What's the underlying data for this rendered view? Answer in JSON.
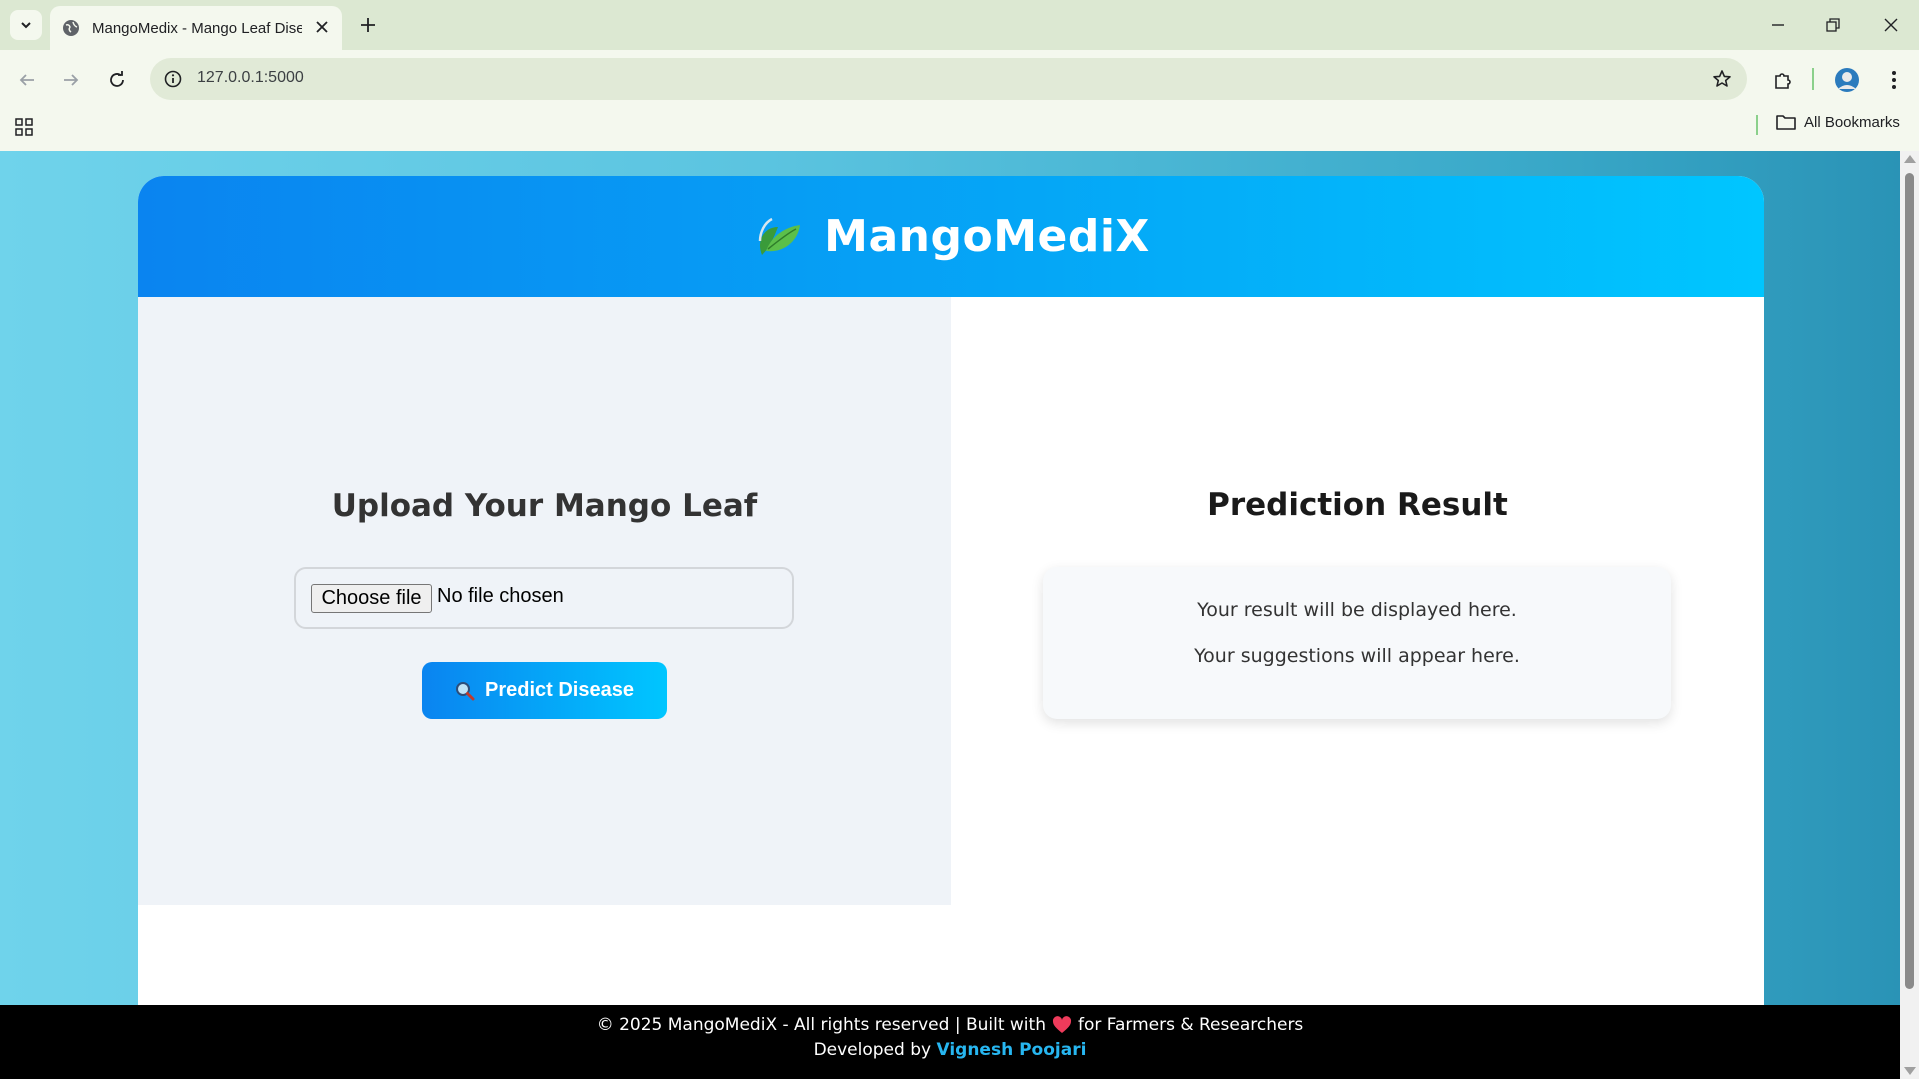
{
  "browser": {
    "tab_title": "MangoMedix - Mango Leaf Disease",
    "url": "127.0.0.1:5000",
    "bookmarks_label": "All Bookmarks"
  },
  "header": {
    "brand": "MangoMediX",
    "logo_icon": "leaf-icon"
  },
  "upload": {
    "title": "Upload Your Mango Leaf",
    "choose_label": "Choose file",
    "file_status": "No file chosen",
    "predict_label": "Predict Disease",
    "predict_icon": "magnifier-icon"
  },
  "result": {
    "title": "Prediction Result",
    "result_text": "Your result will be displayed here.",
    "suggestion_text": "Your suggestions will appear here."
  },
  "footer": {
    "line1_start": "© 2025 MangoMediX - All rights reserved | Built with",
    "line1_end": "for Farmers & Researchers",
    "developed_by": "Developed by",
    "developer": "Vignesh Poojari"
  },
  "colors": {
    "header_start": "#0a84f0",
    "header_end": "#00c6ff",
    "footer_bg": "#000000",
    "link": "#27b6f0"
  }
}
